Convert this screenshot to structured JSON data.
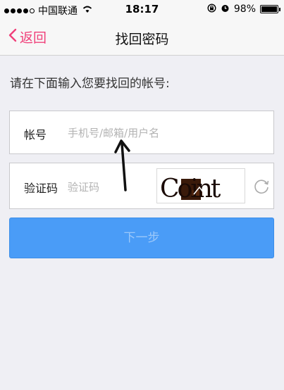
{
  "status_bar": {
    "carrier": "中国联通",
    "time": "18:17",
    "battery": "98%",
    "battery_level": 0.98
  },
  "nav": {
    "back_label": "返回",
    "title": "找回密码"
  },
  "form": {
    "prompt": "请在下面输入您要找回的帐号:",
    "account_label": "帐号",
    "account_placeholder": "手机号/邮箱/用户名",
    "code_label": "验证码",
    "code_placeholder": "验证码",
    "captcha_text": "Coint",
    "next_label": "下一步"
  },
  "colors": {
    "accent_pink": "#f0407a",
    "button_blue": "#4a9cf7"
  }
}
